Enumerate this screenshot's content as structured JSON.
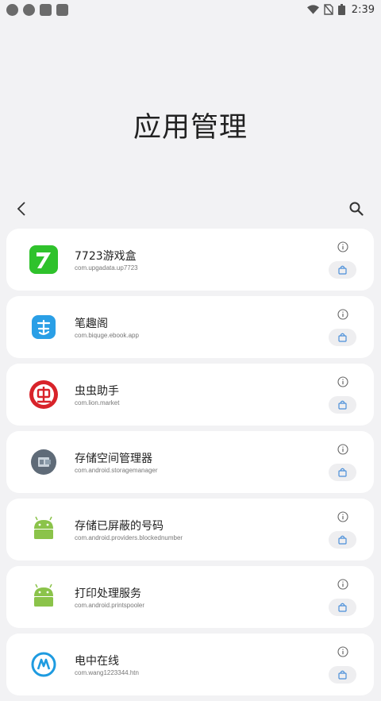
{
  "status_bar": {
    "time": "2:39"
  },
  "page": {
    "title": "应用管理"
  },
  "apps": [
    {
      "name": "7723游戏盒",
      "package": "com.upgadata.up7723",
      "icon": "app-7723-icon"
    },
    {
      "name": "笔趣阁",
      "package": "com.biquge.ebook.app",
      "icon": "app-biquge-icon"
    },
    {
      "name": "虫虫助手",
      "package": "com.lion.market",
      "icon": "app-chongchong-icon"
    },
    {
      "name": "存储空间管理器",
      "package": "com.android.storagemanager",
      "icon": "storage-manager-icon"
    },
    {
      "name": "存储已屏蔽的号码",
      "package": "com.android.providers.blockednumber",
      "icon": "android-icon"
    },
    {
      "name": "打印处理服务",
      "package": "com.android.printspooler",
      "icon": "android-icon"
    },
    {
      "name": "电中在线",
      "package": "com.wang1223344.htn",
      "icon": "app-dianzhong-icon"
    }
  ],
  "colors": {
    "accent": "#4a8fd9",
    "background": "#f2f2f4",
    "card": "#ffffff"
  }
}
